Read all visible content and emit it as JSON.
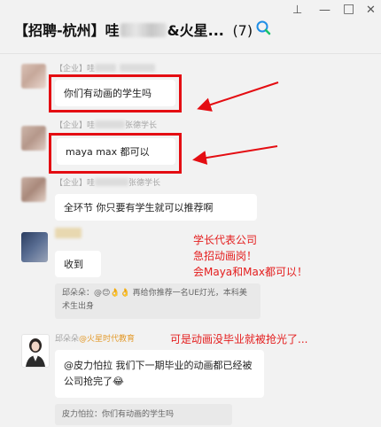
{
  "window": {
    "title_prefix": "【招聘-杭州】哇",
    "title_suffix": "&火星...",
    "member_count": "(7)",
    "pin_icon": "pin-icon",
    "minimize_icon": "minimize-icon",
    "maximize_icon": "maximize-icon",
    "close_icon": "close-icon",
    "pin_glyph": "⊥",
    "minimize_glyph": "—",
    "maximize_glyph": "□",
    "close_glyph": "✕"
  },
  "messages": [
    {
      "sender": "【企业】哇",
      "text": "你们有动画的学生吗"
    },
    {
      "sender": "【企业】哇",
      "sender_suffix": "张德学长",
      "text": "maya max 都可以"
    },
    {
      "sender": "【企业】哇",
      "sender_suffix": "张德学长",
      "text": "全环节 你只要有学生就可以推荐啊"
    },
    {
      "text": "收到",
      "quote": "邱朵朵：@😊👌👌 再给你推荐一名UE灯光，本科美术生出身"
    },
    {
      "sender_name": "邱朵朵",
      "sender_org": "@火星时代教育",
      "text": "@皮力怕拉 我们下一期毕业的动画都已经被公司抢完了😂",
      "quote": "皮力怕拉：你们有动画的学生吗"
    }
  ],
  "annotations": {
    "line1": "学长代表公司",
    "line2": "急招动画岗！",
    "line3": "会Maya和Max都可以！",
    "line4": "可是动画没毕业就被抢光了..."
  },
  "colors": {
    "highlight": "#e40d12",
    "annotation": "#e41d1d",
    "org": "#e39b2d"
  }
}
